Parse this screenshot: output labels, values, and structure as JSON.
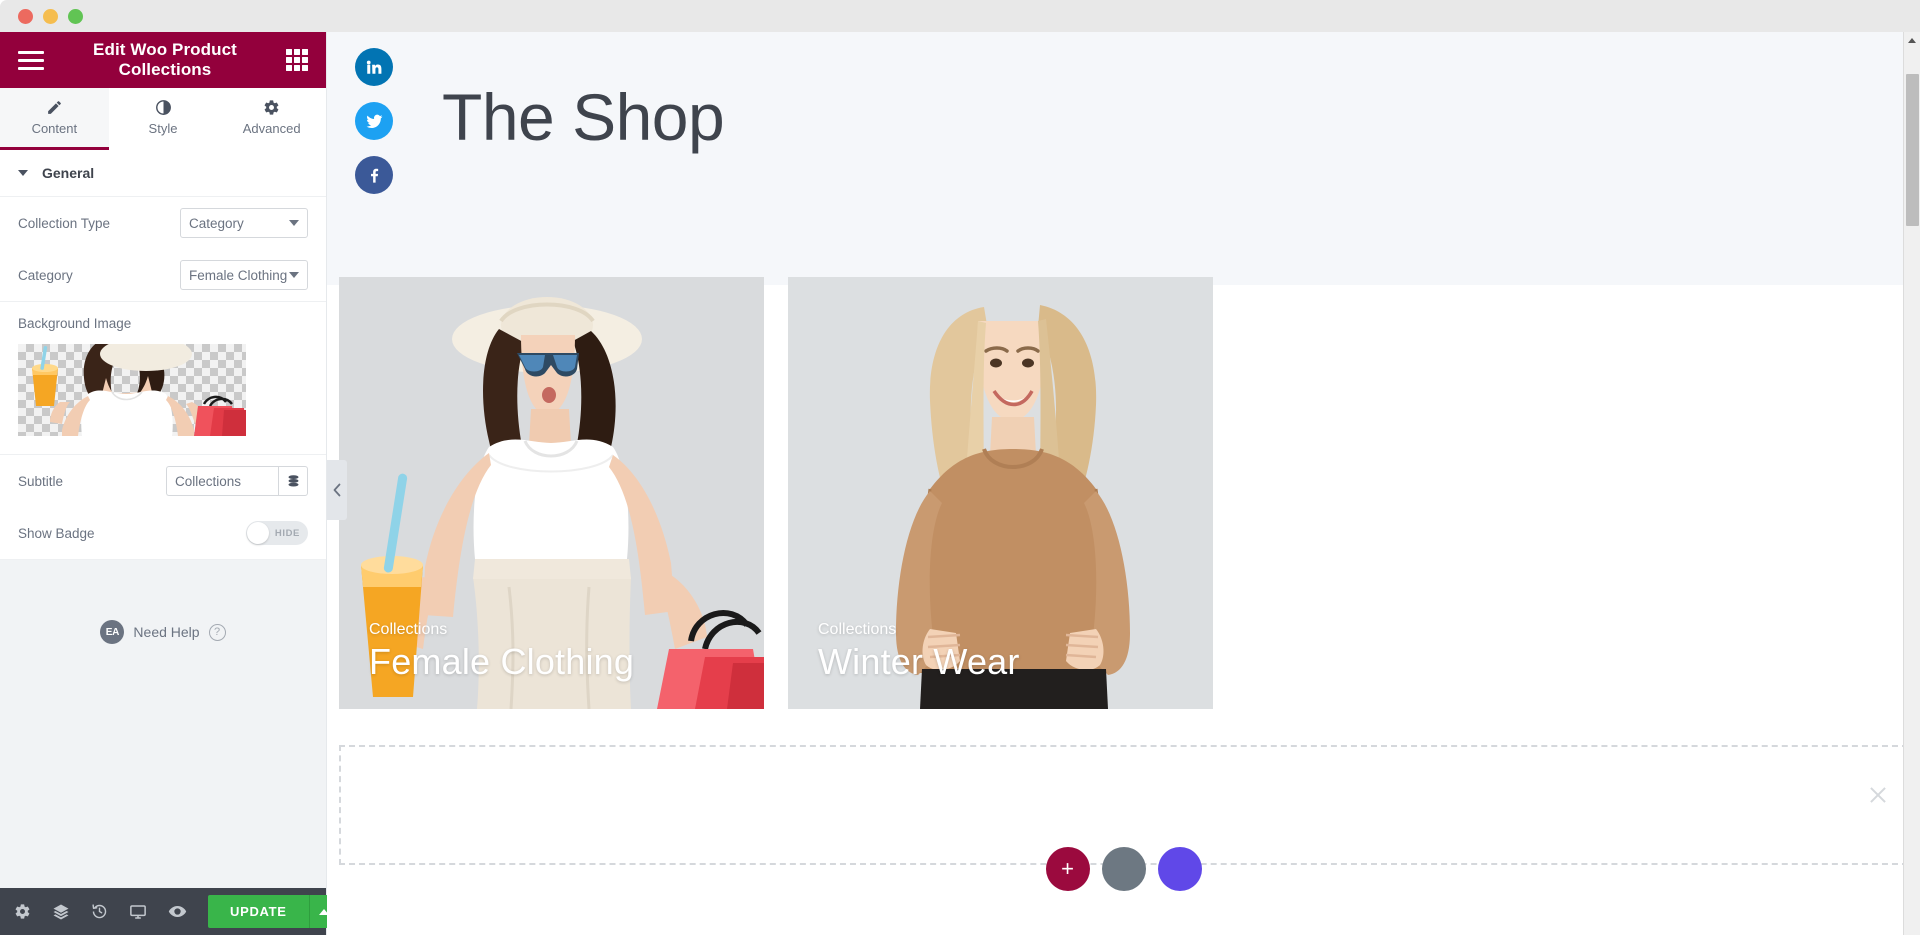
{
  "window": {
    "traffic_lights": [
      "close",
      "minimize",
      "zoom"
    ]
  },
  "panel": {
    "header": {
      "title": "Edit Woo Product Collections",
      "menu_icon": "hamburger-icon",
      "apps_icon": "grid-apps-icon"
    },
    "tabs": [
      {
        "label": "Content",
        "icon": "pencil-icon",
        "active": true
      },
      {
        "label": "Style",
        "icon": "contrast-icon",
        "active": false
      },
      {
        "label": "Advanced",
        "icon": "gear-icon",
        "active": false
      }
    ],
    "sections": [
      {
        "title": "General",
        "expanded": true,
        "controls": [
          {
            "type": "select",
            "label": "Collection Type",
            "value": "Category"
          },
          {
            "type": "select",
            "label": "Category",
            "value": "Female Clothing"
          },
          {
            "type": "media",
            "label": "Background Image"
          },
          {
            "type": "text",
            "label": "Subtitle",
            "value": "Collections",
            "dynamic_icon": "dynamic-tags-icon"
          },
          {
            "type": "switch",
            "label": "Show Badge",
            "state": "HIDE",
            "on": false
          }
        ]
      }
    ],
    "help": {
      "brand": "EA",
      "label": "Need Help",
      "icon": "question-mark-icon"
    },
    "footer": {
      "icons": [
        "settings-gear-icon",
        "navigator-layers-icon",
        "history-clock-icon",
        "responsive-monitor-icon",
        "preview-eye-icon"
      ],
      "update_label": "UPDATE",
      "update_caret": "caret-up-icon"
    },
    "collapse_handle": "chevron-left-icon"
  },
  "canvas": {
    "social": [
      {
        "name": "linkedin",
        "label": "in"
      },
      {
        "name": "twitter",
        "label": "t"
      },
      {
        "name": "facebook",
        "label": "f"
      }
    ],
    "heading": "The Shop",
    "cards": [
      {
        "subtitle": "Collections",
        "title": "Female Clothing",
        "selected": true
      },
      {
        "subtitle": "Collections",
        "title": "Winter Wear",
        "selected": false
      }
    ],
    "add_section": {
      "close_icon": "close-x-icon",
      "buttons": [
        {
          "name": "add-new-section",
          "glyph": "+",
          "color": "#9b0a3e"
        },
        {
          "name": "add-template",
          "glyph": "",
          "color": "#6d7882"
        },
        {
          "name": "add-ai-section",
          "glyph": "",
          "color": "#6048e8"
        }
      ]
    }
  },
  "scrollbar": {
    "up_arrow": "caret-up-icon"
  },
  "colors": {
    "brand_maroon": "#93003c",
    "update_green": "#39b54a",
    "selection_blue": "#59c2f5",
    "footer_dark": "#3f444d",
    "panel_bg": "#f1f3f5"
  }
}
